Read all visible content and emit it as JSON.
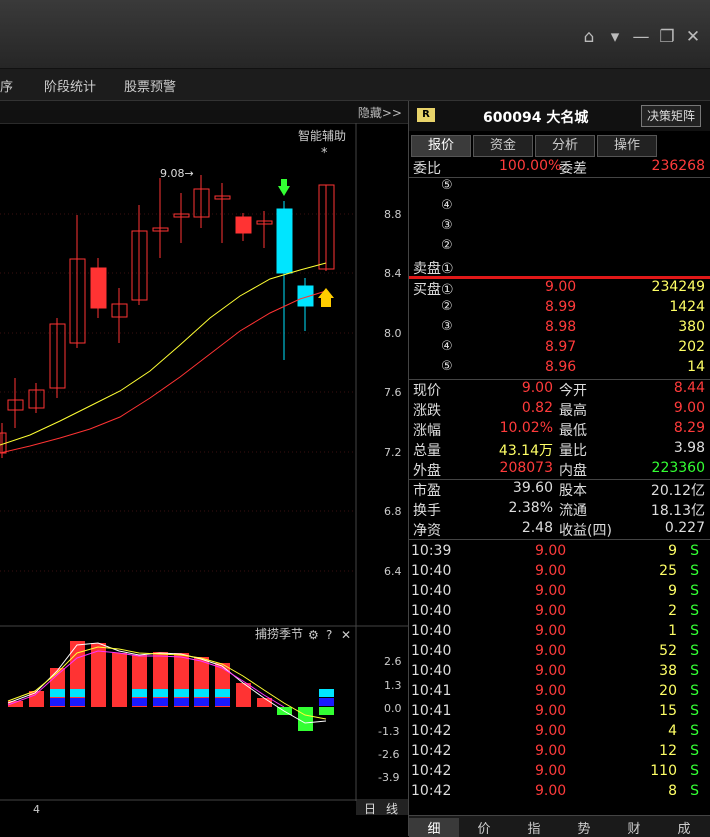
{
  "menu": {
    "items": [
      "序",
      "阶段统计",
      "股票预警"
    ]
  },
  "chart": {
    "hide_label": "隐藏>>",
    "indicator_label": "智能辅助",
    "star": "*",
    "high_label": "9.08→",
    "price_ticks": [
      "8.8",
      "8.4",
      "8.0",
      "7.6",
      "7.2",
      "6.8",
      "6.4"
    ],
    "macd_label": "捕捞季节",
    "macd_ticks": [
      "2.6",
      "1.3",
      "0.0",
      "-1.3",
      "-2.6",
      "-3.9"
    ],
    "date_label": "4",
    "period_label": "日",
    "period_label2": "线",
    "icons": {
      "settings": "⚙",
      "help": "?",
      "close": "✕"
    },
    "colors": {
      "up": "#ff3333",
      "down": "#00e5ff",
      "ma5": "#ffff33",
      "ma10": "#ff3333"
    }
  },
  "stock": {
    "badge": "R",
    "code_name": "600094 大名城",
    "decision_button": "决策矩阵"
  },
  "tabs": [
    "报价",
    "资金",
    "分析",
    "操作"
  ],
  "weibi": {
    "label1": "委比",
    "value1": "100.00%",
    "label2": "委差",
    "value2": "236268"
  },
  "sell": [
    {
      "label": "⑤",
      "price": "",
      "vol": ""
    },
    {
      "label": "④",
      "price": "",
      "vol": ""
    },
    {
      "label": "③",
      "price": "",
      "vol": ""
    },
    {
      "label": "②",
      "price": "",
      "vol": ""
    },
    {
      "label": "卖盘①",
      "price": "",
      "vol": ""
    }
  ],
  "buy": [
    {
      "label": "买盘①",
      "price": "9.00",
      "vol": "234249"
    },
    {
      "label": "②",
      "price": "8.99",
      "vol": "1424"
    },
    {
      "label": "③",
      "price": "8.98",
      "vol": "380"
    },
    {
      "label": "④",
      "price": "8.97",
      "vol": "202"
    },
    {
      "label": "⑤",
      "price": "8.96",
      "vol": "14"
    }
  ],
  "quote": [
    {
      "l1": "现价",
      "v1": "9.00",
      "l2": "今开",
      "v2": "8.44"
    },
    {
      "l1": "涨跌",
      "v1": "0.82",
      "l2": "最高",
      "v2": "9.00"
    },
    {
      "l1": "涨幅",
      "v1": "10.02%",
      "l2": "最低",
      "v2": "8.29"
    },
    {
      "l1": "总量",
      "v1": "43.14万",
      "l2": "量比",
      "v2": "3.98"
    },
    {
      "l1": "外盘",
      "v1": "208073",
      "l2": "内盘",
      "v2": "223360"
    }
  ],
  "fund": [
    {
      "l1": "市盈",
      "v1": "39.60",
      "l2": "股本",
      "v2": "20.12亿"
    },
    {
      "l1": "换手",
      "v1": "2.38%",
      "l2": "流通",
      "v2": "18.13亿"
    },
    {
      "l1": "净资",
      "v1": "2.48",
      "l2": "收益(四)",
      "v2": "0.227"
    }
  ],
  "ticks": [
    {
      "t": "10:39",
      "p": "9.00",
      "v": "9",
      "s": "S"
    },
    {
      "t": "10:40",
      "p": "9.00",
      "v": "25",
      "s": "S"
    },
    {
      "t": "10:40",
      "p": "9.00",
      "v": "9",
      "s": "S"
    },
    {
      "t": "10:40",
      "p": "9.00",
      "v": "2",
      "s": "S"
    },
    {
      "t": "10:40",
      "p": "9.00",
      "v": "1",
      "s": "S"
    },
    {
      "t": "10:40",
      "p": "9.00",
      "v": "52",
      "s": "S"
    },
    {
      "t": "10:40",
      "p": "9.00",
      "v": "38",
      "s": "S"
    },
    {
      "t": "10:41",
      "p": "9.00",
      "v": "20",
      "s": "S"
    },
    {
      "t": "10:41",
      "p": "9.00",
      "v": "15",
      "s": "S"
    },
    {
      "t": "10:42",
      "p": "9.00",
      "v": "4",
      "s": "S"
    },
    {
      "t": "10:42",
      "p": "9.00",
      "v": "12",
      "s": "S"
    },
    {
      "t": "10:42",
      "p": "9.00",
      "v": "110",
      "s": "S"
    },
    {
      "t": "10:42",
      "p": "9.00",
      "v": "8",
      "s": "S"
    }
  ],
  "bottom_tabs": [
    "细",
    "价",
    "指",
    "势",
    "财",
    "成"
  ]
}
